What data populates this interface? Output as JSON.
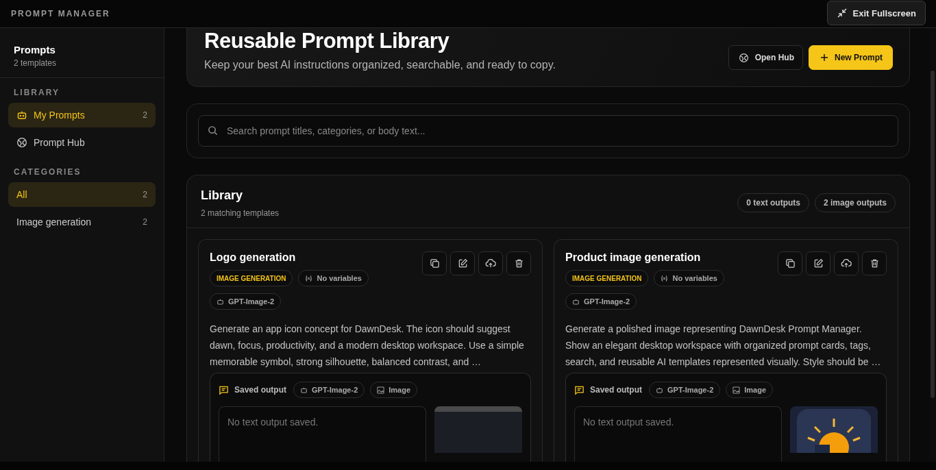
{
  "app": {
    "title": "PROMPT MANAGER",
    "exit_button": "Exit Fullscreen"
  },
  "sidebar": {
    "title": "Prompts",
    "subtitle": "2 templates",
    "sections": [
      {
        "heading": "LIBRARY",
        "items": [
          {
            "label": "My Prompts",
            "count": "2",
            "selected": true,
            "kind": "bot"
          },
          {
            "label": "Prompt Hub",
            "selected": false,
            "kind": "hub"
          }
        ]
      },
      {
        "heading": "CATEGORIES",
        "items": [
          {
            "label": "All",
            "count": "2",
            "selected": true,
            "kind": "plain"
          },
          {
            "label": "Image generation",
            "count": "2",
            "selected": false,
            "kind": "plain"
          }
        ]
      }
    ]
  },
  "hero": {
    "title": "Reusable Prompt Library",
    "subtitle": "Keep your best AI instructions organized, searchable, and ready to copy.",
    "buttons": [
      {
        "label": "Open Hub",
        "kind": "secondary"
      },
      {
        "label": "New Prompt",
        "kind": "primary"
      }
    ]
  },
  "search": {
    "placeholder": "Search prompt titles, categories, or body text..."
  },
  "library": {
    "title": "Library",
    "subtitle": "2 matching templates",
    "badges": [
      "0 text outputs",
      "2 image outputs"
    ],
    "cards": [
      {
        "title": "Logo generation",
        "category": "IMAGE GENERATION",
        "variables": "No variables",
        "model": "GPT-Image-2",
        "body": "Generate an app icon concept for DawnDesk. The icon should suggest dawn, focus, productivity, and a modern desktop workspace. Use a simple memorable symbol, strong silhouette, balanced contrast, and …",
        "output": {
          "label": "Saved output",
          "model": "GPT-Image-2",
          "type": "Image",
          "text": "No text output saved.",
          "kind": "screenshot"
        }
      },
      {
        "title": "Product image generation",
        "category": "IMAGE GENERATION",
        "variables": "No variables",
        "model": "GPT-Image-2",
        "body": "Generate a polished image representing DawnDesk Prompt Manager. Show an elegant desktop workspace with organized prompt cards, tags, search, and reusable AI templates represented visually. Style should be …",
        "output": {
          "label": "Saved output",
          "model": "GPT-Image-2",
          "type": "Image",
          "text": "No text output saved.",
          "kind": "sun"
        }
      }
    ]
  }
}
